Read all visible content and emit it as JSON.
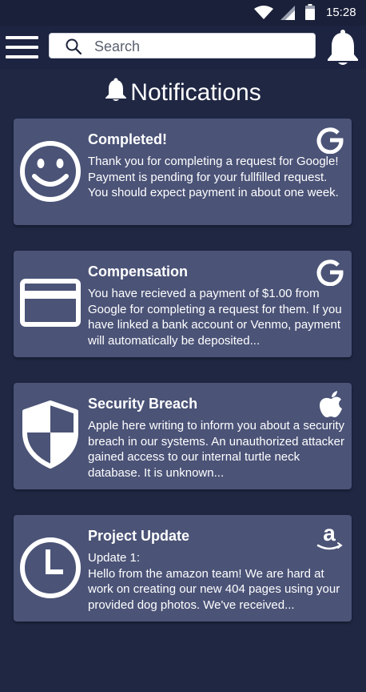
{
  "status_bar": {
    "time": "15:28",
    "icons": [
      "wifi-icon",
      "signal-icon",
      "battery-icon"
    ]
  },
  "header": {
    "menu_icon": "hamburger-menu-icon",
    "search": {
      "placeholder": "Search",
      "value": ""
    },
    "bell_icon": "bell-icon"
  },
  "page": {
    "title": "Notifications",
    "title_icon": "bell-icon"
  },
  "colors": {
    "background": "#1f2743",
    "card": "#4b5377",
    "text": "#ffffff"
  },
  "notifications": [
    {
      "icon": "smiley-face-icon",
      "brand": "google-icon",
      "title": "Completed!",
      "body": "Thank you for completing a request for Google! Payment is pending for your fullfilled request. You should expect payment in about one week."
    },
    {
      "icon": "credit-card-icon",
      "brand": "google-icon",
      "title": "Compensation",
      "body": "You have recieved a payment of $1.00 from Google for completing a request for them. If you have linked a bank account or Venmo, payment will automatically be deposited..."
    },
    {
      "icon": "shield-icon",
      "brand": "apple-icon",
      "title": "Security Breach",
      "body": "Apple here writing to inform you about a security breach in our systems. An unauthorized attacker gained access to our internal turtle neck database. It is unknown..."
    },
    {
      "icon": "clock-icon",
      "brand": "amazon-icon",
      "title": "Project Update",
      "body_line1": "Update 1:",
      "body": "Hello from the amazon team! We are hard at work on creating our new 404 pages using your provided dog photos. We've received..."
    }
  ]
}
